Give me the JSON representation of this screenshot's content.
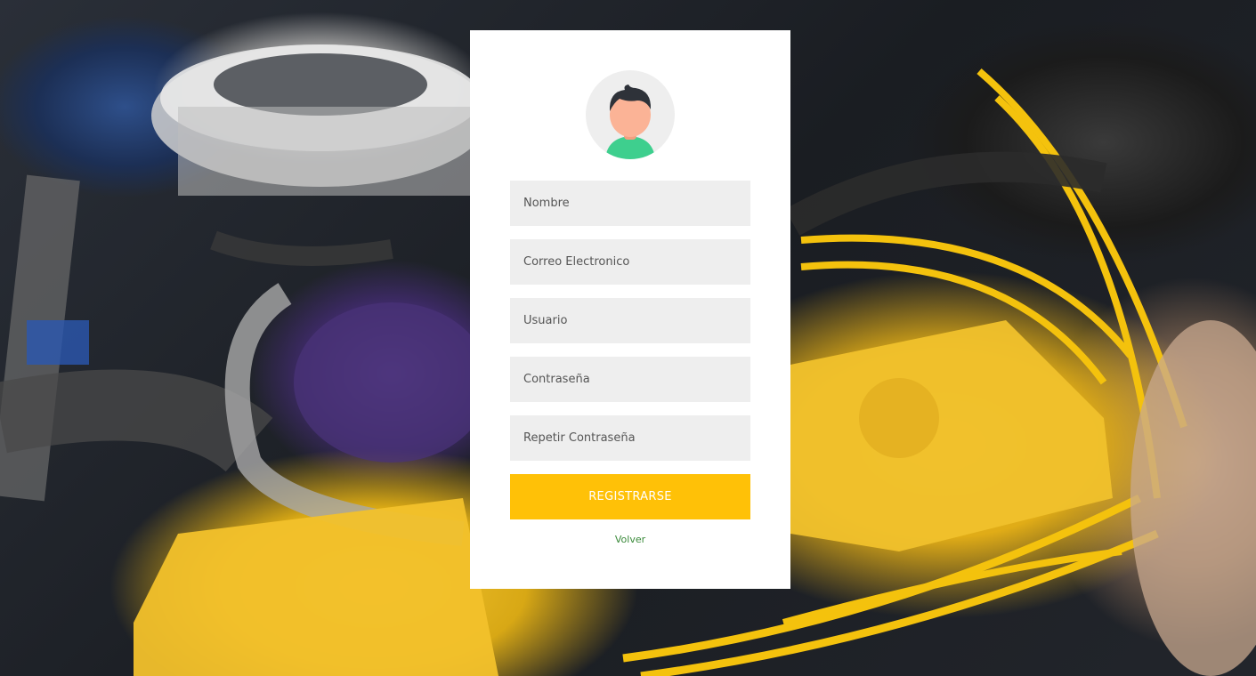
{
  "form": {
    "fields": [
      {
        "placeholder": "Nombre",
        "value": ""
      },
      {
        "placeholder": "Correo Electronico",
        "value": ""
      },
      {
        "placeholder": "Usuario",
        "value": ""
      },
      {
        "placeholder": "Contraseña",
        "value": ""
      },
      {
        "placeholder": "Repetir Contraseña",
        "value": ""
      }
    ],
    "submit_label": "REGISTRARSE",
    "back_link": "Volver"
  },
  "colors": {
    "card_bg": "#ffffff",
    "field_bg": "#eeeeee",
    "button_bg": "#ffc107",
    "link": "#3a8a3a",
    "avatar_skin": "#fbb396",
    "avatar_hair": "#2e3239",
    "avatar_shirt": "#3ecf8e"
  },
  "icons": {
    "avatar": "user-avatar-icon"
  }
}
